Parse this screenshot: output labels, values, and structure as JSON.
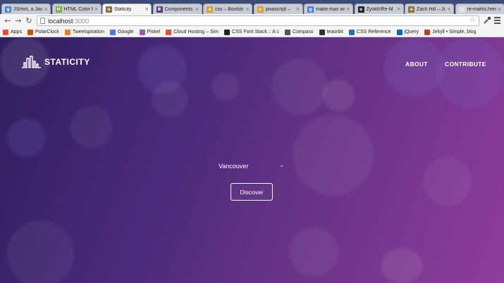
{
  "browser": {
    "tabs": [
      {
        "title": "JSHint, a JavaScr",
        "icon": "google-doc-icon",
        "color": "#4a7de0",
        "glyph": "g",
        "active": false
      },
      {
        "title": "HTML Color Pick",
        "icon": "html-color-icon",
        "color": "#7cb342",
        "glyph": "H",
        "active": false
      },
      {
        "title": "Staticity",
        "icon": "staticity-icon",
        "color": "#8d6e3f",
        "glyph": "o",
        "active": true
      },
      {
        "title": "Components",
        "icon": "bootstrap-icon",
        "color": "#563d7c",
        "glyph": "B",
        "active": false
      },
      {
        "title": "css – Bootstra",
        "icon": "stackoverflow-icon",
        "color": "#e0a030",
        "glyph": "s",
        "active": false
      },
      {
        "title": "javascript – ",
        "icon": "stackoverflow-icon",
        "color": "#e0a030",
        "glyph": "s",
        "active": false
      },
      {
        "title": "make max wi",
        "icon": "google-icon",
        "color": "#4a7de0",
        "glyph": "g",
        "active": false
      },
      {
        "title": "Zynkh/Re-M",
        "icon": "github-icon",
        "color": "#222222",
        "glyph": "o",
        "active": false
      },
      {
        "title": "Zach Hill – Ju",
        "icon": "monkey-icon",
        "color": "#8d6e3f",
        "glyph": "o",
        "active": false
      },
      {
        "title": "re-marks.herok",
        "icon": "page-icon",
        "color": "#e0e0e0",
        "glyph": "",
        "active": false
      }
    ],
    "url_host": "localhost",
    "url_port": ":3000",
    "bookmarks": [
      {
        "label": "Apps",
        "icon": "apps-grid-icon",
        "color": "#e74c3c"
      },
      {
        "label": "PolarClock",
        "icon": "polarclock-icon",
        "color": "#d35400"
      },
      {
        "label": "Tweetspiration",
        "icon": "tweet-icon",
        "color": "#e67e22"
      },
      {
        "label": "Google",
        "icon": "google-icon",
        "color": "#4a7de0"
      },
      {
        "label": "Piskel",
        "icon": "piskel-icon",
        "color": "#9b59b6"
      },
      {
        "label": "Cloud Hosting – Sim",
        "icon": "cloud-icon",
        "color": "#e74c3c"
      },
      {
        "label": "CSS Font Stack :: A c",
        "icon": "fontstack-icon",
        "color": "#222222"
      },
      {
        "label": "Compass",
        "icon": "compass-icon",
        "color": "#555555"
      },
      {
        "label": "teaorbit",
        "icon": "teaorbit-icon",
        "color": "#333333"
      },
      {
        "label": "CSS Reference",
        "icon": "css-reference-icon",
        "color": "#2c6fb7"
      },
      {
        "label": "jQuery",
        "icon": "jquery-icon",
        "color": "#0769ad"
      },
      {
        "label": "Jekyll • Simple, blog",
        "icon": "jekyll-icon",
        "color": "#c0392b"
      }
    ]
  },
  "site": {
    "logo_text": "STATICITY",
    "nav": {
      "about": "ABOUT",
      "contribute": "CONTRIBUTE"
    },
    "city_select": {
      "value": "Vancouver"
    },
    "discover_label": "Discover"
  }
}
